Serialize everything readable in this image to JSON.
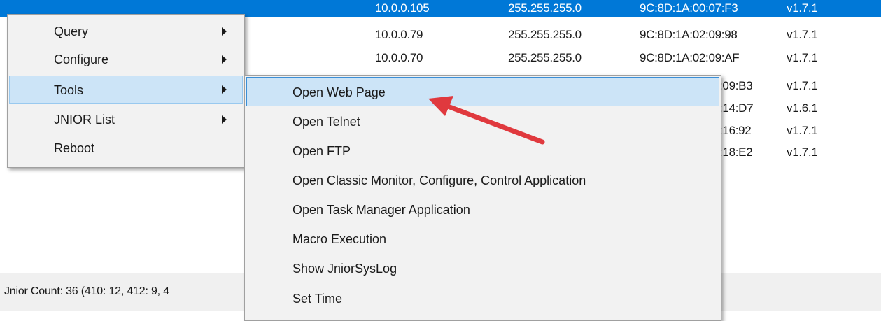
{
  "rows": [
    {
      "ip": "10.0.0.105",
      "mask": "255.255.255.0",
      "mac": "9C:8D:1A:00:07:F3",
      "version": "v1.7.1"
    },
    {
      "ip": "10.0.0.79",
      "mask": "255.255.255.0",
      "mac": "9C:8D:1A:02:09:98",
      "version": "v1.7.1"
    },
    {
      "ip": "10.0.0.70",
      "mask": "255.255.255.0",
      "mac": "9C:8D:1A:02:09:AF",
      "version": "v1.7.1"
    },
    {
      "mac": ":09:B3",
      "version": "v1.7.1"
    },
    {
      "mac": ":14:D7",
      "version": "v1.6.1"
    },
    {
      "mac": ":16:92",
      "version": "v1.7.1"
    },
    {
      "mac": ":18:E2",
      "version": "v1.7.1"
    }
  ],
  "context_menu": {
    "items": [
      {
        "label": "Query",
        "has_submenu": true
      },
      {
        "label": "Configure",
        "has_submenu": true
      },
      {
        "label": "Tools",
        "has_submenu": true
      },
      {
        "label": "JNIOR List",
        "has_submenu": true
      },
      {
        "label": "Reboot",
        "has_submenu": false
      }
    ]
  },
  "tools_submenu": {
    "items": [
      {
        "label": "Open Web Page"
      },
      {
        "label": "Open Telnet"
      },
      {
        "label": "Open FTP"
      },
      {
        "label": "Open Classic Monitor, Configure, Control Application"
      },
      {
        "label": "Open Task Manager Application"
      },
      {
        "label": "Macro Execution"
      },
      {
        "label": "Show JniorSysLog"
      },
      {
        "label": "Set Time"
      }
    ]
  },
  "status_bar": {
    "text": "Jnior Count: 36  (410: 12,  412: 9, 4"
  },
  "colors": {
    "selection": "#0078d7",
    "menu_highlight": "#cce4f7",
    "arrow": "#e0393e"
  }
}
